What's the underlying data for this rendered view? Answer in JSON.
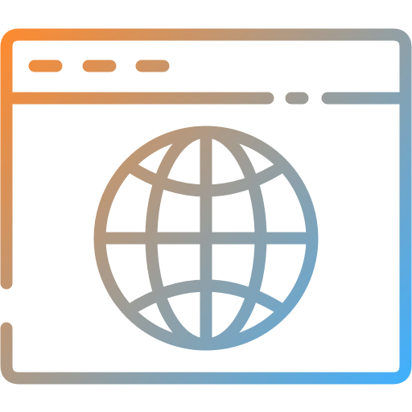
{
  "icon": {
    "name": "browser-globe-icon",
    "parts": {
      "window": "browser-window-icon",
      "globe": "globe-icon"
    },
    "gradient": {
      "start_color": "#ff8a2e",
      "end_color": "#3fb0ff"
    }
  }
}
